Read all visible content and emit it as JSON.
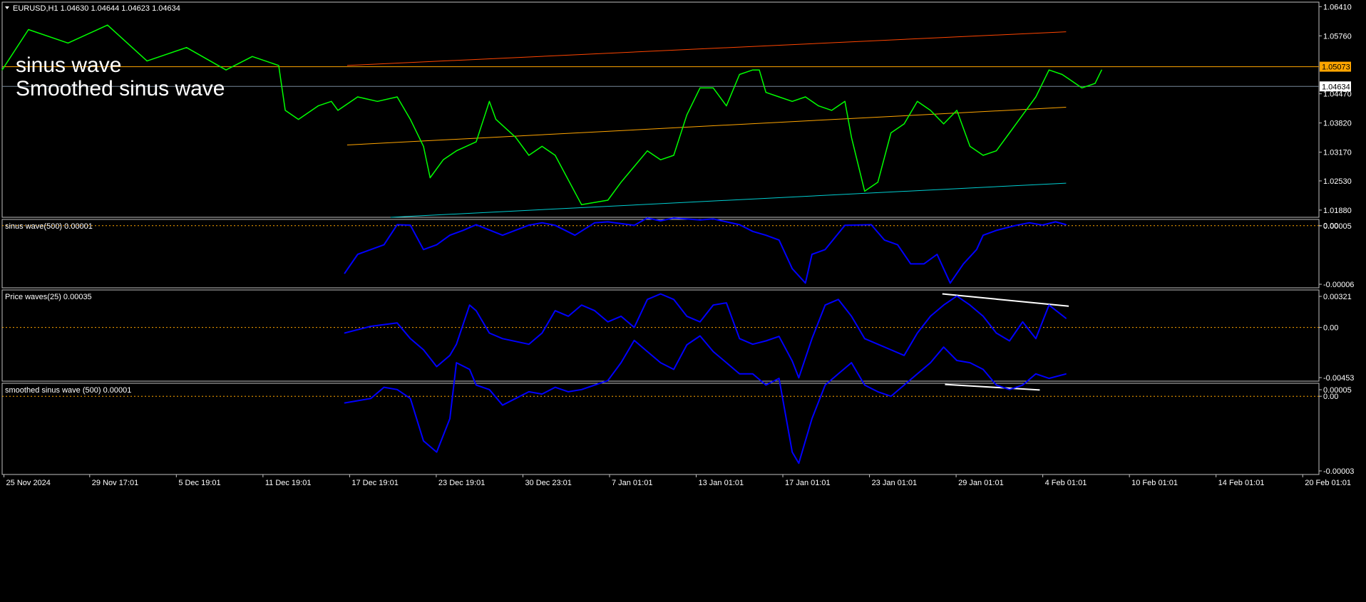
{
  "header": {
    "symbol": "EURUSD,H1",
    "ohlc": "1.04630 1.04644 1.04623 1.04634"
  },
  "overlay_labels": [
    "sinus wave",
    "Smoothed sinus wave"
  ],
  "colors": {
    "background": "#000000",
    "frame": "#c0c0c0",
    "price_line": "#00ff00",
    "indicator_line": "#0000ff",
    "zero_line": "#ffa500",
    "channel_top": "#ff4500",
    "channel_mid": "#ffa500",
    "channel_bottom": "#00ced1",
    "resistance_line": "#ffa500",
    "bid_line": "#778899",
    "divergence_line": "#ffffff",
    "label_text": "#ffffff",
    "axis_text": "#ffffff",
    "price_tag_bg": "#ffa500",
    "bid_tag_bg": "#ffffff"
  },
  "x_axis": {
    "labels": [
      "25 Nov 2024",
      "29 Nov 17:01",
      "5 Dec 19:01",
      "11 Dec 19:01",
      "17 Dec 19:01",
      "23 Dec 19:01",
      "30 Dec 23:01",
      "7 Jan 01:01",
      "13 Jan 01:01",
      "17 Jan 01:01",
      "23 Jan 01:01",
      "29 Jan 01:01",
      "4 Feb 01:01",
      "10 Feb 01:01",
      "14 Feb 01:01",
      "20 Feb 01:01"
    ]
  },
  "chart_data": [
    {
      "id": "price",
      "type": "line",
      "title": "EURUSD,H1",
      "ylim": [
        1.0172,
        1.0651
      ],
      "y_ticks": [
        "1.06410",
        "1.05760",
        "1.05073",
        "1.04634",
        "1.04470",
        "1.03820",
        "1.03170",
        "1.02530",
        "1.01880"
      ],
      "price_tags": [
        {
          "label": "1.05073",
          "value": 1.05073,
          "style": "resistance"
        },
        {
          "label": "1.04634",
          "value": 1.04634,
          "style": "bid"
        }
      ],
      "series": [
        {
          "x": [
            0.0,
            0.02,
            0.05,
            0.08,
            0.11,
            0.14,
            0.17,
            0.19,
            0.21,
            0.215,
            0.225,
            0.24,
            0.25,
            0.255,
            0.27,
            0.285,
            0.3,
            0.31,
            0.32,
            0.325,
            0.335,
            0.345,
            0.36,
            0.37,
            0.375,
            0.39,
            0.4,
            0.41,
            0.42,
            0.44,
            0.46,
            0.47,
            0.49,
            0.5,
            0.51,
            0.52,
            0.53,
            0.54,
            0.55,
            0.56,
            0.57,
            0.575,
            0.58,
            0.59,
            0.6,
            0.61,
            0.62,
            0.63,
            0.64,
            0.645,
            0.655,
            0.665,
            0.675,
            0.685,
            0.695,
            0.705,
            0.715,
            0.725,
            0.735,
            0.745,
            0.755,
            0.765,
            0.775,
            0.785,
            0.795,
            0.805,
            0.81,
            0.82,
            0.83,
            0.835
          ],
          "values": [
            1.05,
            1.059,
            1.056,
            1.06,
            1.052,
            1.055,
            1.05,
            1.053,
            1.051,
            1.041,
            1.039,
            1.042,
            1.043,
            1.041,
            1.044,
            1.043,
            1.044,
            1.039,
            1.033,
            1.026,
            1.03,
            1.032,
            1.034,
            1.043,
            1.039,
            1.035,
            1.031,
            1.033,
            1.031,
            1.02,
            1.021,
            1.025,
            1.032,
            1.03,
            1.031,
            1.04,
            1.046,
            1.046,
            1.042,
            1.049,
            1.05,
            1.05,
            1.045,
            1.044,
            1.043,
            1.044,
            1.042,
            1.041,
            1.043,
            1.035,
            1.023,
            1.025,
            1.036,
            1.038,
            1.043,
            1.041,
            1.038,
            1.041,
            1.033,
            1.031,
            1.032,
            1.036,
            1.04,
            1.044,
            1.05,
            1.049,
            1.048,
            1.046,
            1.047,
            1.05
          ]
        }
      ],
      "trendlines": [
        {
          "name": "channel-top",
          "x": [
            0.262,
            0.808
          ],
          "y": [
            1.051,
            1.0585
          ]
        },
        {
          "name": "channel-mid",
          "x": [
            0.262,
            0.808
          ],
          "y": [
            1.0333,
            1.0417
          ]
        },
        {
          "name": "channel-bottom",
          "x": [
            0.295,
            0.808
          ],
          "y": [
            1.0172,
            1.0248
          ]
        }
      ],
      "hlines": [
        {
          "name": "resistance",
          "value": 1.05073
        },
        {
          "name": "bid",
          "value": 1.04634
        }
      ]
    },
    {
      "id": "sinus-wave",
      "type": "line",
      "title": "sinus wave(500) 0.00001",
      "ylim": [
        -6.5e-05,
        6.5e-06
      ],
      "y_ticks": [
        "0.00005",
        "0.00",
        "-0.00006"
      ],
      "series": [
        {
          "x": [
            0.26,
            0.27,
            0.29,
            0.3,
            0.31,
            0.32,
            0.33,
            0.34,
            0.35,
            0.36,
            0.38,
            0.4,
            0.41,
            0.42,
            0.435,
            0.45,
            0.46,
            0.48,
            0.49,
            0.5,
            0.51,
            0.53,
            0.54,
            0.55,
            0.56,
            0.57,
            0.58,
            0.59,
            0.6,
            0.61,
            0.615,
            0.625,
            0.64,
            0.66,
            0.67,
            0.68,
            0.69,
            0.7,
            0.71,
            0.72,
            0.73,
            0.74,
            0.745,
            0.755,
            0.77,
            0.78,
            0.79,
            0.8,
            0.808
          ],
          "values": [
            -5e-05,
            -3e-05,
            -2e-05,
            1e-06,
            5e-07,
            -2.5e-05,
            -2e-05,
            -1e-05,
            -5e-06,
            1e-06,
            -1e-05,
            5e-07,
            3e-06,
            3e-07,
            -1e-05,
            3e-06,
            4e-06,
            3e-07,
            8e-06,
            5e-06,
            8e-06,
            6e-06,
            7e-06,
            4e-06,
            1e-06,
            -6e-06,
            -1e-05,
            -1.5e-05,
            -4.5e-05,
            -6e-05,
            -3e-05,
            -2.5e-05,
            3e-07,
            1e-06,
            -1.5e-05,
            -2e-05,
            -4e-05,
            -4e-05,
            -3e-05,
            -6e-05,
            -4e-05,
            -2.5e-05,
            -1e-05,
            -5e-06,
            3e-07,
            3e-06,
            6e-07,
            4e-06,
            1e-06
          ]
        }
      ]
    },
    {
      "id": "price-waves",
      "type": "line",
      "title": "Price waves(25) 0.00035",
      "ylim": [
        -0.0048,
        0.00335
      ],
      "y_ticks": [
        "0.00321",
        "0.00",
        "-0.00453"
      ],
      "series": [
        {
          "x": [
            0.26,
            0.28,
            0.3,
            0.31,
            0.32,
            0.33,
            0.34,
            0.345,
            0.355,
            0.36,
            0.37,
            0.38,
            0.4,
            0.41,
            0.42,
            0.43,
            0.44,
            0.45,
            0.46,
            0.47,
            0.48,
            0.49,
            0.5,
            0.51,
            0.52,
            0.53,
            0.54,
            0.55,
            0.56,
            0.57,
            0.58,
            0.59,
            0.6,
            0.605,
            0.615,
            0.625,
            0.635,
            0.645,
            0.655,
            0.665,
            0.675,
            0.685,
            0.695,
            0.705,
            0.715,
            0.725,
            0.735,
            0.745,
            0.755,
            0.765,
            0.775,
            0.785,
            0.795,
            0.808
          ],
          "values": [
            -0.0005,
            0.0001,
            0.0004,
            -0.001,
            -0.002,
            -0.0035,
            -0.0025,
            -0.0015,
            0.002,
            0.0015,
            -0.0005,
            -0.001,
            -0.0015,
            -0.0005,
            0.0015,
            0.001,
            0.002,
            0.0015,
            0.0005,
            0.001,
            0.0,
            0.0025,
            0.003,
            0.0025,
            0.001,
            0.0005,
            0.002,
            0.0022,
            -0.001,
            -0.0015,
            -0.0012,
            -0.0008,
            -0.003,
            -0.0045,
            -0.001,
            0.002,
            0.0025,
            0.001,
            -0.001,
            -0.0015,
            -0.002,
            -0.0025,
            -0.0005,
            0.001,
            0.002,
            0.0028,
            0.002,
            0.001,
            -0.0005,
            -0.0012,
            0.0005,
            -0.001,
            0.002,
            0.0008
          ]
        }
      ],
      "trendlines": [
        {
          "name": "divergence",
          "x": [
            0.714,
            0.81
          ],
          "y": [
            0.003,
            0.0019
          ]
        }
      ]
    },
    {
      "id": "smoothed-sinus-wave",
      "type": "line",
      "title": "smoothed sinus wave  (500) 0.00001",
      "ylim": [
        -3.5e-05,
        5.8e-06
      ],
      "y_ticks": [
        "0.00005",
        "0.00",
        "-0.00003"
      ],
      "series": [
        {
          "x": [
            0.26,
            0.28,
            0.29,
            0.3,
            0.31,
            0.32,
            0.33,
            0.34,
            0.345,
            0.355,
            0.36,
            0.37,
            0.38,
            0.4,
            0.41,
            0.42,
            0.43,
            0.44,
            0.45,
            0.46,
            0.47,
            0.48,
            0.49,
            0.5,
            0.51,
            0.52,
            0.53,
            0.54,
            0.55,
            0.56,
            0.57,
            0.58,
            0.59,
            0.6,
            0.605,
            0.615,
            0.625,
            0.635,
            0.645,
            0.655,
            0.665,
            0.675,
            0.685,
            0.695,
            0.705,
            0.715,
            0.725,
            0.735,
            0.745,
            0.755,
            0.765,
            0.775,
            0.785,
            0.795,
            0.808
          ],
          "values": [
            -3e-06,
            -1e-06,
            4e-06,
            3e-06,
            -1e-06,
            -2e-05,
            -2.5e-05,
            -1e-05,
            1.5e-05,
            1.2e-05,
            5e-06,
            3e-06,
            -4e-06,
            2e-06,
            1e-06,
            4e-06,
            2e-06,
            3e-06,
            5e-06,
            7e-06,
            1.5e-05,
            2.5e-05,
            2e-05,
            1.5e-05,
            1.2e-05,
            2.3e-05,
            2.7e-05,
            2e-05,
            1.5e-05,
            1e-05,
            1e-05,
            5e-06,
            8e-06,
            -2.5e-05,
            -3e-05,
            -1e-05,
            5e-06,
            1e-05,
            1.5e-05,
            5e-06,
            2e-06,
            0.0,
            5e-06,
            1e-05,
            1.5e-05,
            2.2e-05,
            1.6e-05,
            1.5e-05,
            1.2e-05,
            5e-06,
            3e-06,
            5e-06,
            1e-05,
            8e-06,
            1e-05
          ]
        }
      ],
      "trendlines": [
        {
          "name": "divergence",
          "x": [
            0.716,
            0.788
          ],
          "y": [
            5.3e-06,
            2.8e-06
          ]
        }
      ]
    }
  ]
}
